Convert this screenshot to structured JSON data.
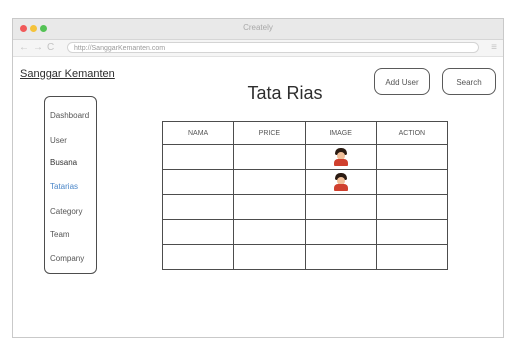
{
  "window": {
    "title": "Creately"
  },
  "browser": {
    "back_glyph": "←",
    "forward_glyph": "→",
    "reload_glyph": "C",
    "url": "http://SanggarKemanten.com",
    "menu_glyph": "≡"
  },
  "header": {
    "brand": "Sanggar Kemanten",
    "page_title": "Tata Rias",
    "add_user_label": "Add User",
    "search_label": "Search"
  },
  "sidebar": {
    "items": [
      {
        "label": "Dashboard",
        "active": false
      },
      {
        "label": "User",
        "active": false
      },
      {
        "label": "Busana",
        "active": false
      },
      {
        "label": "Tatarias",
        "active": true
      },
      {
        "label": "Category",
        "active": false
      },
      {
        "label": "Team",
        "active": false
      },
      {
        "label": "Company",
        "active": false
      }
    ]
  },
  "table": {
    "columns": [
      "NAMA",
      "PRICE",
      "IMAGE",
      "ACTION"
    ],
    "rows": [
      {
        "nama": "",
        "price": "",
        "has_image": true,
        "action": ""
      },
      {
        "nama": "",
        "price": "",
        "has_image": true,
        "action": ""
      },
      {
        "nama": "",
        "price": "",
        "has_image": false,
        "action": ""
      },
      {
        "nama": "",
        "price": "",
        "has_image": false,
        "action": ""
      },
      {
        "nama": "",
        "price": "",
        "has_image": false,
        "action": ""
      }
    ]
  },
  "colors": {
    "active_link": "#4a86c8",
    "close": "#f15a5a",
    "minimize": "#f5c33b",
    "maximize": "#54c255"
  }
}
